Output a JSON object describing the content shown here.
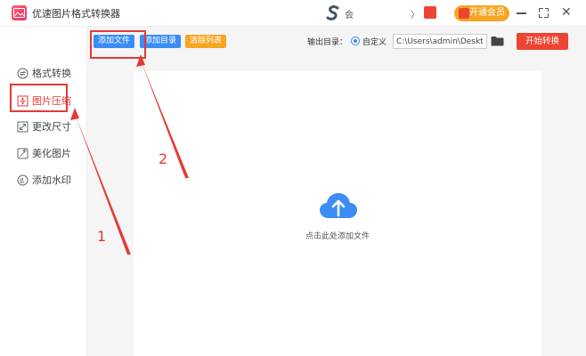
{
  "window": {
    "title": "优速图片格式转换器",
    "user_name": "会",
    "more": "〉",
    "vip_label": "开通会员",
    "close": "✕"
  },
  "toolbar": {
    "add_file": "添加文件",
    "add_folder": "添加目录",
    "clear_list": "清除列表",
    "output_dir_label": "输出目录：",
    "custom_label": "自定义",
    "output_path": "C:\\Users\\admin\\Deskto",
    "start_button": "开始转换"
  },
  "sidebar": {
    "items": [
      {
        "label": "格式转换",
        "icon": "format-convert-icon",
        "active": false
      },
      {
        "label": "图片压缩",
        "icon": "image-compress-icon",
        "active": true
      },
      {
        "label": "更改尺寸",
        "icon": "resize-icon",
        "active": false
      },
      {
        "label": "美化图片",
        "icon": "beautify-icon",
        "active": false
      },
      {
        "label": "添加水印",
        "icon": "watermark-icon",
        "active": false
      }
    ]
  },
  "main": {
    "drop_hint": "点击此处添加文件"
  },
  "annotations": {
    "step1": "1",
    "step2": "2"
  },
  "colors": {
    "accent_blue": "#3b8cf5",
    "accent_red": "#ee4433",
    "accent_orange": "#f6a623",
    "annotation_red": "#e53935"
  }
}
